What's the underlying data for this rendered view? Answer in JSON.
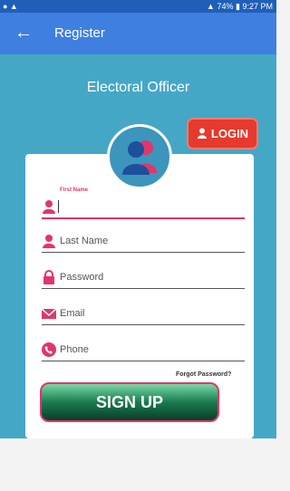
{
  "status_bar": {
    "time": "9:27 PM",
    "battery": "74%"
  },
  "app_bar": {
    "back_icon": "arrow-left-icon",
    "title": "Register"
  },
  "hero": {
    "title": "Electoral Officer",
    "avatar_icon": "users-icon"
  },
  "login_button": {
    "label": "LOGIN",
    "icon": "user-icon"
  },
  "form": {
    "first_name": {
      "float_label": "First Name",
      "value": "",
      "icon": "user-icon"
    },
    "last_name": {
      "placeholder": "Last Name",
      "icon": "user-icon"
    },
    "password": {
      "placeholder": "Password",
      "icon": "lock-icon"
    },
    "email": {
      "placeholder": "Email",
      "icon": "mail-icon"
    },
    "phone": {
      "placeholder": "Phone",
      "icon": "phone-icon"
    },
    "forgot_password": "Forgot Password?",
    "signup_label": "SIGN UP"
  },
  "colors": {
    "primary": "#3f7fe0",
    "status_bar": "#1f5fb8",
    "hero": "#45a7c6",
    "accent": "#e1366a",
    "login": "#e53a2d",
    "signup": "#1a7b4f"
  }
}
